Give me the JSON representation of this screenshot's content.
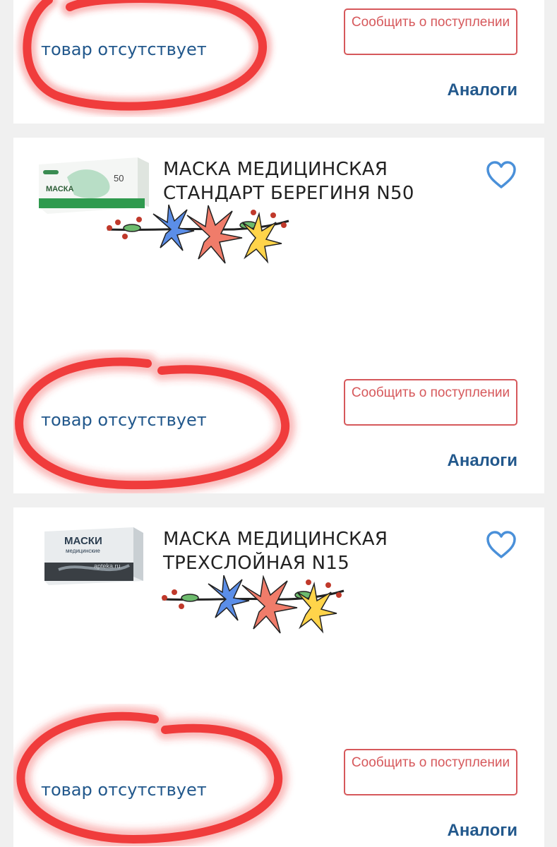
{
  "products": [
    {
      "title": "",
      "status": "товар отсутствует",
      "notify_label": "Сообщить о поступлении",
      "analogs_label": "Аналоги"
    },
    {
      "title": "МАСКА МЕДИЦИНСКАЯ СТАНДАРТ БЕРЕГИНЯ N50",
      "thumb": {
        "box_title": "МАСКА",
        "count": "50"
      },
      "status": "товар отсутствует",
      "notify_label": "Сообщить о поступлении",
      "analogs_label": "Аналоги"
    },
    {
      "title": "МАСКА МЕДИЦИНСКАЯ ТРЕХСЛОЙНАЯ N15",
      "thumb": {
        "box_title": "МАСКИ",
        "box_subtitle": "медицинские",
        "watermark": "apteka.ru"
      },
      "status": "товар отсутствует",
      "notify_label": "Сообщить о поступлении",
      "analogs_label": "Аналоги"
    }
  ],
  "icons": {
    "favorite": "heart-outline-icon"
  },
  "colors": {
    "accent_blue": "#22588c",
    "notify_red": "#d6585b",
    "heart_blue": "#4a90d9",
    "scribble_red": "#f03c3c"
  }
}
